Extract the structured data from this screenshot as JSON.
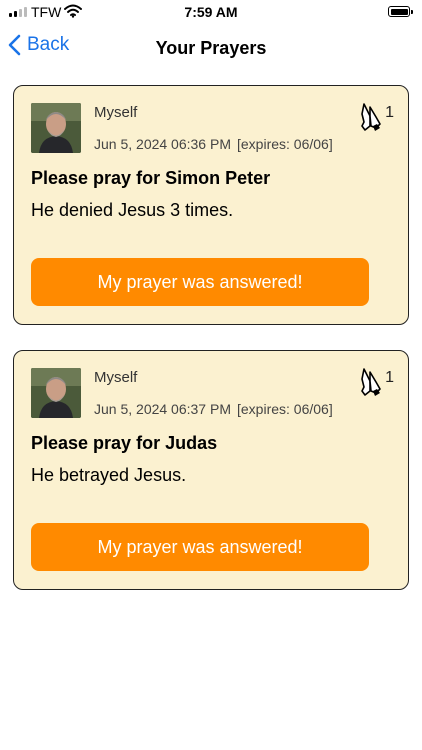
{
  "status_bar": {
    "carrier": "TFW",
    "time": "7:59 AM"
  },
  "nav": {
    "back_label": "Back",
    "title": "Your Prayers"
  },
  "prayers": [
    {
      "author": "Myself",
      "date": "Jun 5, 2024 06:36 PM",
      "expires": "[expires: 06/06]",
      "prayer_count": "1",
      "title": "Please pray for Simon Peter",
      "body": "He denied Jesus 3 times.",
      "answered_label": "My prayer was answered!"
    },
    {
      "author": "Myself",
      "date": "Jun 5, 2024 06:37 PM",
      "expires": "[expires: 06/06]",
      "prayer_count": "1",
      "title": "Please pray for Judas",
      "body": "He betrayed Jesus.",
      "answered_label": "My prayer was answered!"
    }
  ],
  "colors": {
    "accent": "#ff8a00",
    "card_bg": "#fbf1d0",
    "link": "#1a73e8"
  },
  "icons": [
    "signal-icon",
    "wifi-icon",
    "battery-icon",
    "back-chevron-icon",
    "praying-hands-icon"
  ]
}
